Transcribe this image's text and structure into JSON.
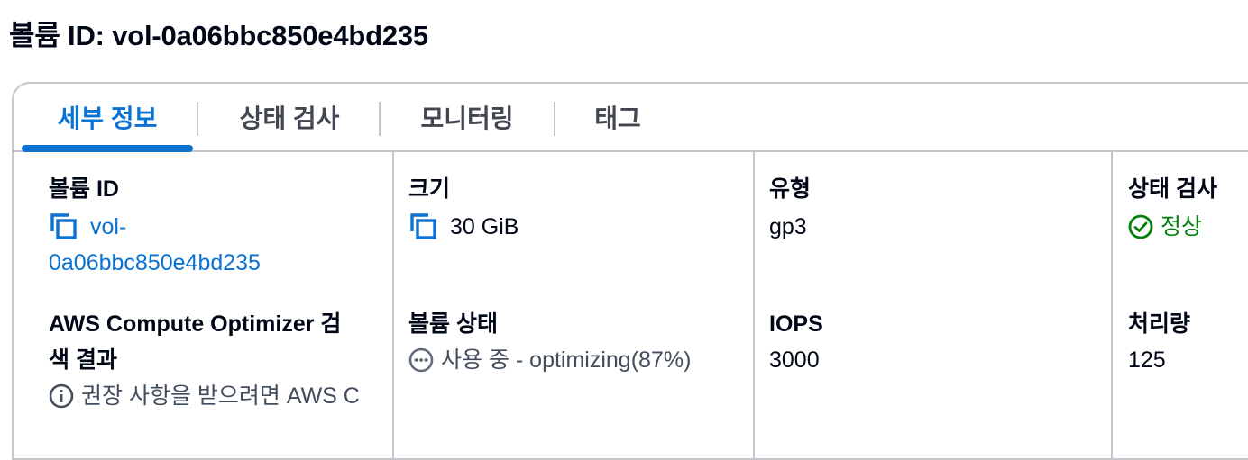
{
  "page": {
    "title": "볼륨 ID: vol-0a06bbc850e4bd235"
  },
  "tabs": [
    {
      "label": "세부 정보",
      "active": true
    },
    {
      "label": "상태 검사",
      "active": false
    },
    {
      "label": "모니터링",
      "active": false
    },
    {
      "label": "태그",
      "active": false
    }
  ],
  "details": {
    "volume_id": {
      "label": "볼륨 ID",
      "value_line1": "vol-",
      "value_line2": "0a06bbc850e4bd235",
      "icon": "copy-icon"
    },
    "size": {
      "label": "크기",
      "value": "30 GiB",
      "icon": "copy-icon"
    },
    "type": {
      "label": "유형",
      "value": "gp3"
    },
    "status_check": {
      "label": "상태 검사",
      "value": "정상",
      "icon": "check-circle-icon"
    },
    "compute_optimizer": {
      "label_line1": "AWS Compute Optimizer 검",
      "label_line2": "색 결과",
      "value": "권장 사항을 받으려면 AWS C",
      "icon": "info-icon"
    },
    "volume_state": {
      "label": "볼륨 상태",
      "value": "사용 중 - optimizing(87%)",
      "icon": "in-progress-icon"
    },
    "iops": {
      "label": "IOPS",
      "value": "3000"
    },
    "throughput": {
      "label": "처리량",
      "value": "125"
    }
  },
  "colors": {
    "accent": "#0972d3",
    "success": "#037f0c",
    "muted": "#5f6b7a",
    "border": "#c6c6cd",
    "text": "#000716"
  }
}
